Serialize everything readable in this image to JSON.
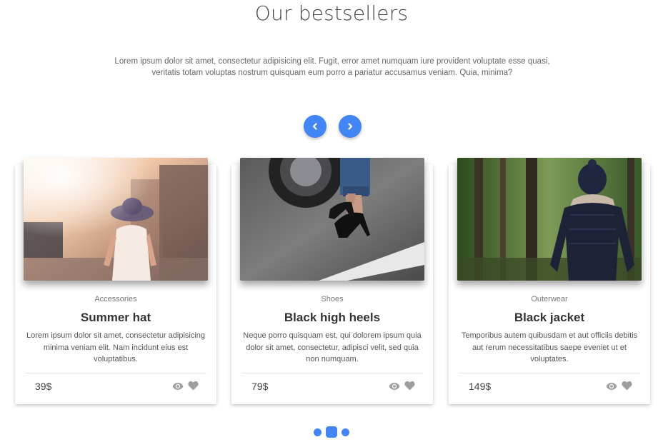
{
  "section": {
    "title": "Our bestsellers",
    "description": "Lorem ipsum dolor sit amet, consectetur adipisicing elit. Fugit, error amet numquam iure provident voluptate esse quasi, veritatis totam voluptas nostrum quisquam eum porro a pariatur accusamus veniam. Quia, minima?"
  },
  "controls": {
    "prev_icon": "chevron-left-icon",
    "next_icon": "chevron-right-icon",
    "accent_color": "#4285f4"
  },
  "products": [
    {
      "category": "Accessories",
      "name": "Summer hat",
      "description": "Lorem ipsum dolor sit amet, consectetur adipisicing minima veniam elit. Nam incidunt eius est voluptatibus.",
      "price": "39$"
    },
    {
      "category": "Shoes",
      "name": "Black high heels",
      "description": "Neque porro quisquam est, qui dolorem ipsum quia dolor sit amet, consectetur, adipisci velit, sed quia non numquam.",
      "price": "79$"
    },
    {
      "category": "Outerwear",
      "name": "Black jacket",
      "description": "Temporibus autem quibusdam et aut officiis debitis aut rerum necessitatibus saepe eveniet ut et voluptates.",
      "price": "149$"
    }
  ],
  "pagination": {
    "pages": 3,
    "active": 2
  }
}
